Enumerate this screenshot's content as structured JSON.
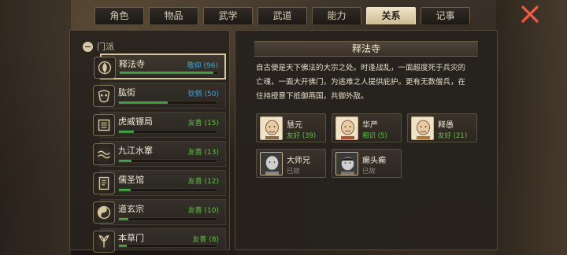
{
  "tabs": [
    {
      "label": "角色",
      "active": false
    },
    {
      "label": "物品",
      "active": false
    },
    {
      "label": "武学",
      "active": false
    },
    {
      "label": "武道",
      "active": false
    },
    {
      "label": "能力",
      "active": false
    },
    {
      "label": "关系",
      "active": true
    },
    {
      "label": "记事",
      "active": false
    }
  ],
  "group": {
    "label": "门派"
  },
  "sects": [
    {
      "name": "释法寺",
      "relation": "敬仰 (96)",
      "value": 96,
      "color": "#3fa7d8",
      "active": true
    },
    {
      "name": "肱街",
      "relation": "钦佩 (50)",
      "value": 50,
      "color": "#3fa7d8",
      "active": false
    },
    {
      "name": "虎威镖局",
      "relation": "友善 (15)",
      "value": 15,
      "color": "#62c246",
      "active": false
    },
    {
      "name": "九江水寨",
      "relation": "友善 (13)",
      "value": 13,
      "color": "#62c246",
      "active": false
    },
    {
      "name": "儒圣馆",
      "relation": "友善 (12)",
      "value": 12,
      "color": "#62c246",
      "active": false
    },
    {
      "name": "道玄宗",
      "relation": "友善 (10)",
      "value": 10,
      "color": "#62c246",
      "active": false
    },
    {
      "name": "本草门",
      "relation": "友善 (8)",
      "value": 8,
      "color": "#62c246",
      "active": false
    }
  ],
  "detail": {
    "title": "释法寺",
    "description": "自古便是天下佛法的大宗之处。时逢战乱，一面超度死于兵灾的亡魂，一面大开佛门，为逃难之人提供庇护。更有无数僧兵，在住持授意下抵御燕国，共御外敌。",
    "members": [
      {
        "name": "慧元",
        "relation": "友好 (39)",
        "color": "#62c246",
        "dead": false
      },
      {
        "name": "华严",
        "relation": "相识 (5)",
        "color": "#62c246",
        "dead": false
      },
      {
        "name": "释愚",
        "relation": "友好 (21)",
        "color": "#62c246",
        "dead": false
      },
      {
        "name": "大师兄",
        "relation": "已故",
        "color": "#8c8478",
        "dead": true
      },
      {
        "name": "癞头癫",
        "relation": "已故",
        "color": "#8c8478",
        "dead": true
      }
    ]
  },
  "colors": {
    "accent": "#d8c8a0",
    "close": "#e04a3a"
  }
}
